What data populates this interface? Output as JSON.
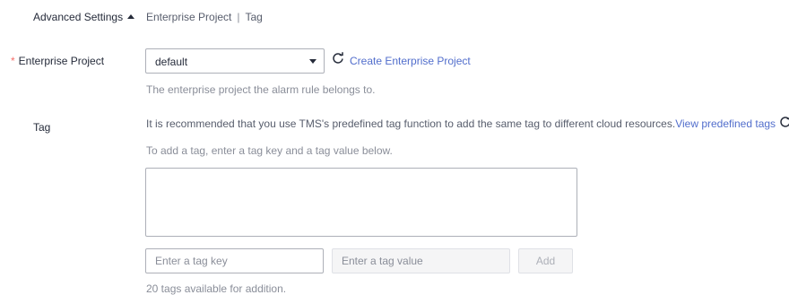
{
  "advanced": {
    "toggle_label": "Advanced Settings",
    "summary_project": "Enterprise Project",
    "summary_sep": "|",
    "summary_tag": "Tag"
  },
  "enterprise_project": {
    "label": "Enterprise Project",
    "required_mark": "*",
    "selected": "default",
    "create_link": "Create Enterprise Project",
    "help": "The enterprise project the alarm rule belongs to."
  },
  "tag": {
    "label": "Tag",
    "recommend_text": "It is recommended that you use TMS's predefined tag function to add the same tag to different cloud resources.",
    "view_link": "View predefined tags",
    "help": "To add a tag, enter a tag key and a tag value below.",
    "key_placeholder": "Enter a tag key",
    "value_placeholder": "Enter a tag value",
    "add_label": "Add",
    "count_text": "20 tags available for addition."
  },
  "icons": {
    "refresh": "refresh-icon",
    "dropdown": "chevron-down-icon",
    "collapse": "caret-up-icon"
  },
  "colors": {
    "link": "#526ecc",
    "required": "#f66f6a",
    "text": "#252b3a",
    "muted": "#575d6c"
  }
}
